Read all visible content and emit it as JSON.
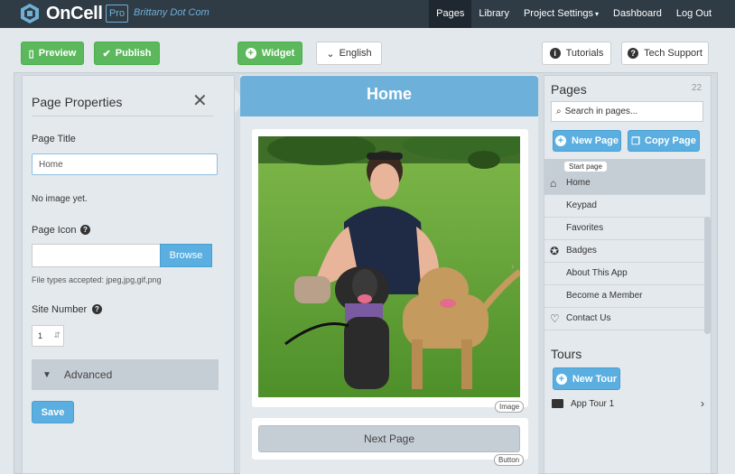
{
  "topnav": {
    "logo_text": "OnCell",
    "pro_label": "Pro",
    "account_name": "Brittany Dot Com",
    "links": [
      {
        "label": "Pages"
      },
      {
        "label": "Library"
      },
      {
        "label": "Project Settings"
      },
      {
        "label": "Dashboard"
      },
      {
        "label": "Log Out"
      }
    ]
  },
  "toolbar": {
    "preview_label": "Preview",
    "publish_label": "Publish",
    "widget_label": "Widget",
    "language_label": "English",
    "tutorials_label": "Tutorials",
    "support_label": "Tech Support"
  },
  "properties": {
    "title": "Page Properties",
    "page_title_label": "Page Title",
    "page_title_value": "Home",
    "no_image_text": "No image yet.",
    "page_icon_label": "Page Icon",
    "browse_label": "Browse",
    "file_types_note": "File types accepted: jpeg,jpg,gif,png",
    "site_number_label": "Site Number",
    "site_number_value": "1",
    "advanced_label": "Advanced",
    "save_label": "Save"
  },
  "preview": {
    "header_title": "Home",
    "image_tag": "Image",
    "next_page_label": "Next Page",
    "button_tag": "Button"
  },
  "pages_panel": {
    "title": "Pages",
    "count": "22",
    "search_placeholder": "Search in pages...",
    "new_page_label": "New Page",
    "copy_page_label": "Copy Page",
    "start_page_tag": "Start page",
    "items": [
      {
        "label": "Home",
        "icon": "home-icon"
      },
      {
        "label": "Keypad",
        "icon": ""
      },
      {
        "label": "Favorites",
        "icon": ""
      },
      {
        "label": "Badges",
        "icon": "badge-icon"
      },
      {
        "label": "About This App",
        "icon": ""
      },
      {
        "label": "Become a Member",
        "icon": ""
      },
      {
        "label": "Contact Us",
        "icon": "heart-icon"
      }
    ],
    "tours_title": "Tours",
    "new_tour_label": "New Tour",
    "tours": [
      {
        "label": "App Tour 1",
        "icon": "folder-icon"
      }
    ]
  },
  "colors": {
    "nav_bg": "#2f3b45",
    "accent_blue": "#6db1db",
    "button_green": "#5cb85c",
    "button_blue": "#5aaee0"
  }
}
